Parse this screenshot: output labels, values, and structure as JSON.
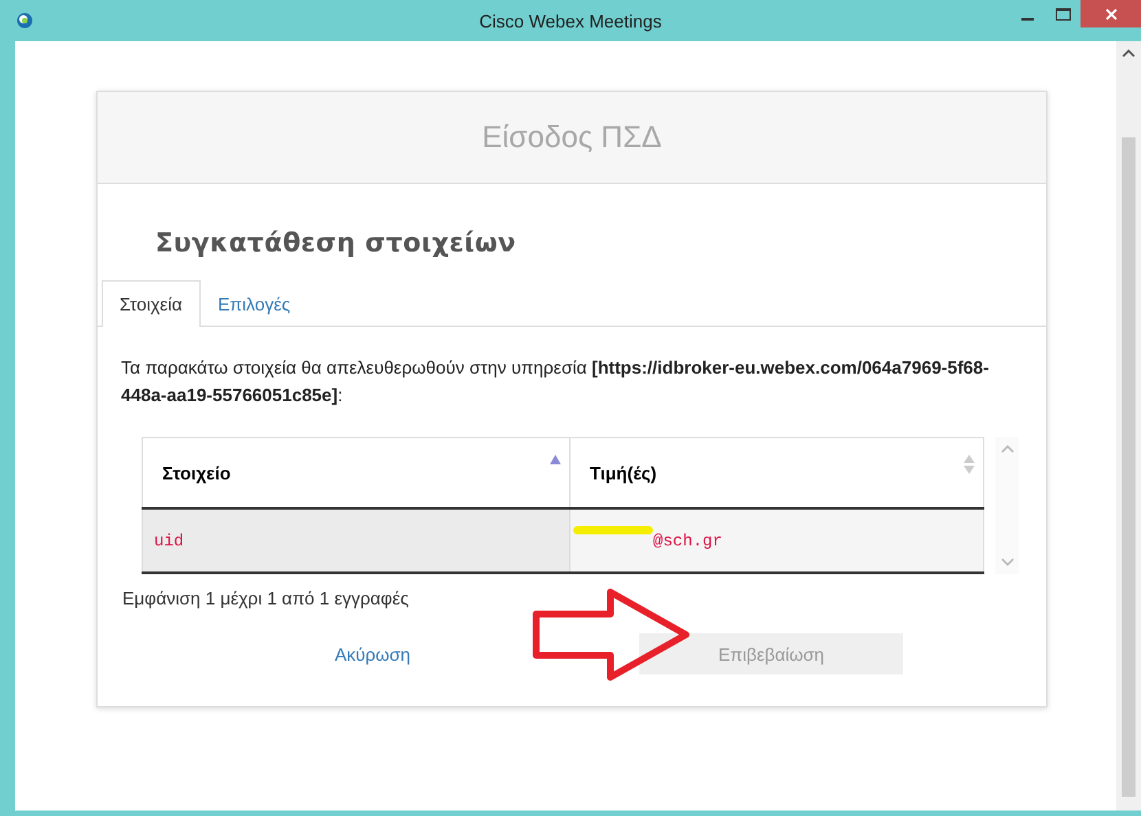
{
  "window": {
    "title": "Cisco Webex Meetings"
  },
  "card": {
    "header": "Είσοδος ΠΣΔ",
    "heading": "Συγκατάθεση στοιχείων"
  },
  "tabs": [
    {
      "label": "Στοιχεία",
      "selected": true
    },
    {
      "label": "Επιλογές",
      "selected": false
    }
  ],
  "description": "Τα παρακάτω στοιχεία θα απελευθερωθούν στην υπηρεσία **[https://idbroker-eu.webex.com/064a7969-5f68-448a-aa19-55766051c85e]**:",
  "table": {
    "columns": [
      {
        "label": "Στοιχείο",
        "sorted": true
      },
      {
        "label": "Τιμή(ές)",
        "sorted": false
      }
    ],
    "rows": [
      {
        "cells": [
          "uid",
          "@sch.gr"
        ],
        "redacted": true
      }
    ],
    "info": "Εμφάνιση 1 μέχρι 1 από 1 εγγραφές"
  },
  "buttons": [
    {
      "label": "Ακύρωση",
      "kind": "link"
    },
    {
      "label": "Επιβεβαίωση",
      "kind": "primary",
      "disabled": true
    }
  ]
}
